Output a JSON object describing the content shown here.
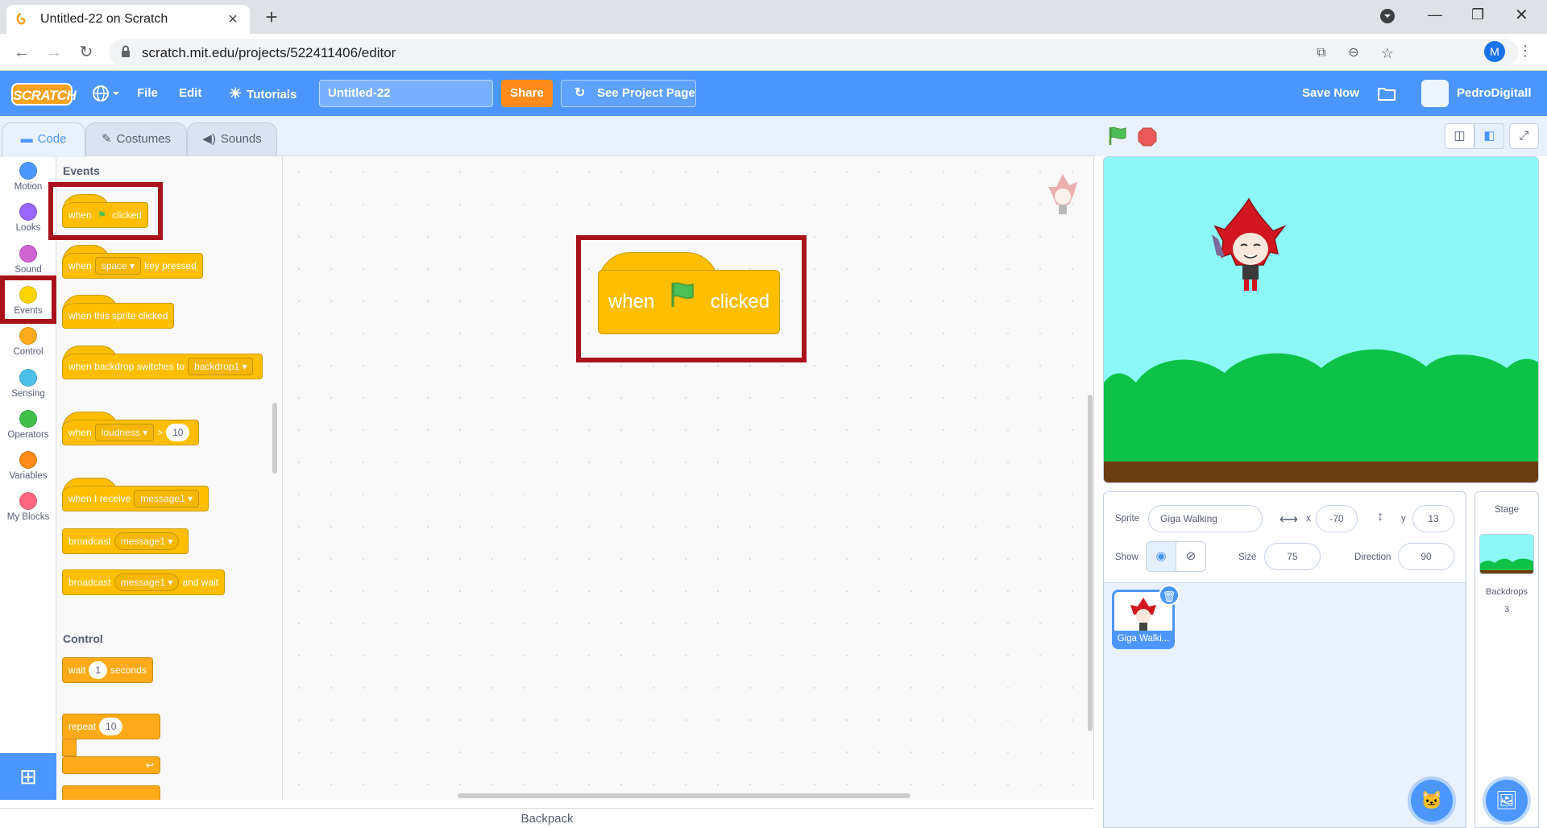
{
  "browser": {
    "tab_title": "Untitled-22 on Scratch",
    "url": "scratch.mit.edu/projects/522411406/editor",
    "profile_initial": "M"
  },
  "menu": {
    "logo": "SCRATCH",
    "file": "File",
    "edit": "Edit",
    "tutorials": "Tutorials",
    "project_title": "Untitled-22",
    "share": "Share",
    "see_project": "See Project Page",
    "save_now": "Save Now",
    "username": "PedroDigitall"
  },
  "tabs": {
    "code": "Code",
    "costumes": "Costumes",
    "sounds": "Sounds"
  },
  "categories": [
    {
      "label": "Motion",
      "color": "#4c97ff"
    },
    {
      "label": "Looks",
      "color": "#9966ff"
    },
    {
      "label": "Sound",
      "color": "#cf63cf"
    },
    {
      "label": "Events",
      "color": "#ffd500"
    },
    {
      "label": "Control",
      "color": "#ffab19"
    },
    {
      "label": "Sensing",
      "color": "#4cbfe6"
    },
    {
      "label": "Operators",
      "color": "#40bf4a"
    },
    {
      "label": "Variables",
      "color": "#ff8c1a"
    },
    {
      "label": "My Blocks",
      "color": "#ff6680"
    }
  ],
  "palette": {
    "events_header": "Events",
    "control_header": "Control",
    "b1": {
      "a": "when",
      "b": "clicked"
    },
    "b2": {
      "a": "when",
      "dd": "space",
      "b": "key pressed"
    },
    "b3": {
      "a": "when this sprite clicked"
    },
    "b4": {
      "a": "when backdrop switches to",
      "dd": "backdrop1"
    },
    "b5": {
      "a": "when",
      "dd": "loudness",
      "op": ">",
      "val": "10"
    },
    "b6": {
      "a": "when I receive",
      "dd": "message1"
    },
    "b7": {
      "a": "broadcast",
      "dd": "message1"
    },
    "b8": {
      "a": "broadcast",
      "dd": "message1",
      "b": "and wait"
    },
    "c1": {
      "a": "wait",
      "val": "1",
      "b": "seconds"
    },
    "c2": {
      "a": "repeat",
      "val": "10"
    }
  },
  "script": {
    "when": "when",
    "clicked": "clicked"
  },
  "backpack": "Backpack",
  "sprite_info": {
    "sprite_label": "Sprite",
    "sprite_name": "Giga Walking",
    "x_label": "x",
    "x_value": "-70",
    "y_label": "y",
    "y_value": "13",
    "show_label": "Show",
    "size_label": "Size",
    "size_value": "75",
    "direction_label": "Direction",
    "direction_value": "90"
  },
  "sprite_list": [
    {
      "name": "Giga Walki..."
    }
  ],
  "stage_pane": {
    "title": "Stage",
    "backdrops_label": "Backdrops",
    "backdrops_count": "3"
  }
}
